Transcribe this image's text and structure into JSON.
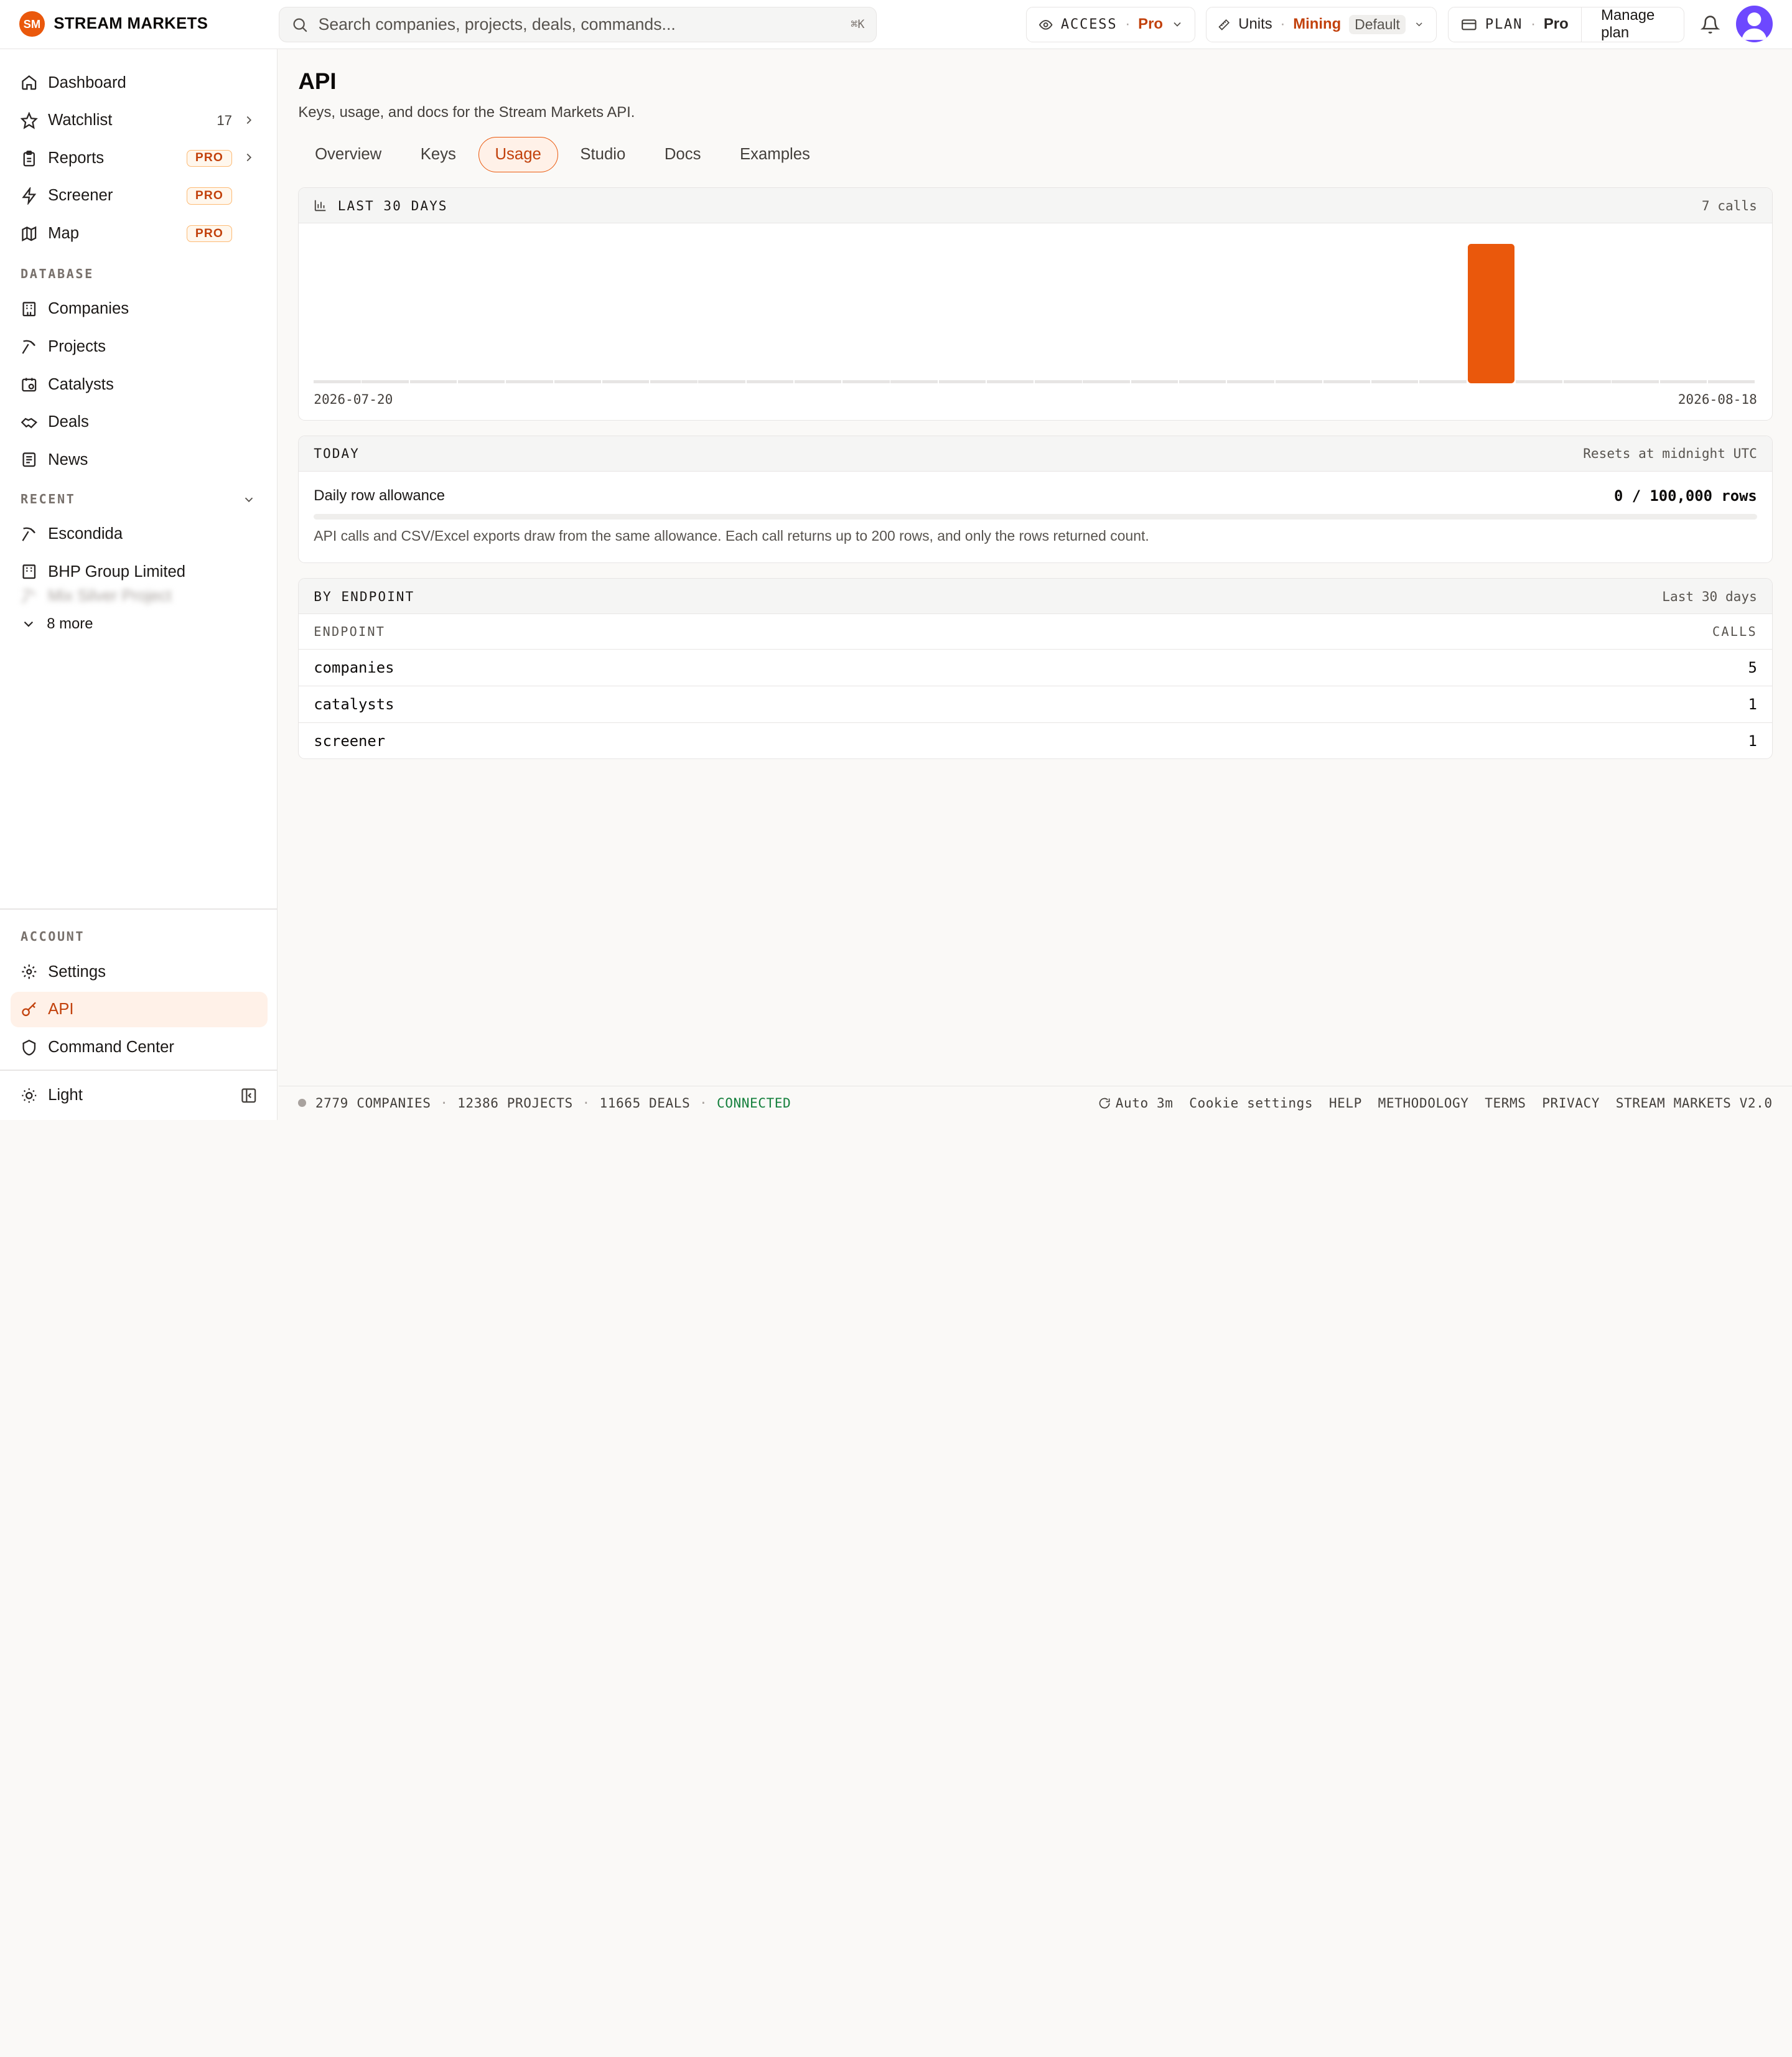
{
  "brand": {
    "logo_text": "SM",
    "name": "STREAM MARKETS"
  },
  "search": {
    "placeholder": "Search companies, projects, deals, commands...",
    "shortcut": "⌘K"
  },
  "access": {
    "label": "ACCESS",
    "value": "Pro"
  },
  "units": {
    "label": "Units",
    "value": "Mining",
    "chip": "Default"
  },
  "plan": {
    "label": "PLAN",
    "value": "Pro",
    "manage": "Manage plan"
  },
  "sidebar": {
    "main": [
      {
        "label": "Dashboard"
      },
      {
        "label": "Watchlist",
        "count": "17"
      },
      {
        "label": "Reports",
        "badge": "PRO"
      },
      {
        "label": "Screener",
        "badge": "PRO"
      },
      {
        "label": "Map",
        "badge": "PRO"
      }
    ],
    "database_label": "DATABASE",
    "database": [
      {
        "label": "Companies"
      },
      {
        "label": "Projects"
      },
      {
        "label": "Catalysts"
      },
      {
        "label": "Deals"
      },
      {
        "label": "News"
      }
    ],
    "recent_label": "RECENT",
    "recent": [
      {
        "label": "Escondida"
      },
      {
        "label": "BHP Group Limited"
      },
      {
        "label": "Mix Silver Project"
      }
    ],
    "more_label": "8 more",
    "account_label": "ACCOUNT",
    "account": [
      {
        "label": "Settings"
      },
      {
        "label": "API"
      },
      {
        "label": "Command Center"
      }
    ],
    "theme_label": "Light"
  },
  "page": {
    "title": "API",
    "subtitle": "Keys, usage, and docs for the Stream Markets API.",
    "tabs": [
      "Overview",
      "Keys",
      "Usage",
      "Studio",
      "Docs",
      "Examples"
    ]
  },
  "usage_chart": {
    "title": "LAST 30 DAYS",
    "meta": "7 calls"
  },
  "chart_data": {
    "type": "bar",
    "title": "LAST 30 DAYS",
    "x_start": "2026-07-20",
    "x_end": "2026-08-18",
    "values": [
      0,
      0,
      0,
      0,
      0,
      0,
      0,
      0,
      0,
      0,
      0,
      0,
      0,
      0,
      0,
      0,
      0,
      0,
      0,
      0,
      0,
      0,
      0,
      0,
      7,
      0,
      0,
      0,
      0,
      0
    ],
    "ylim": [
      0,
      7
    ],
    "color": "#ea580c"
  },
  "today": {
    "title": "TODAY",
    "meta": "Resets at midnight UTC",
    "allowance_label": "Daily row allowance",
    "allowance_value": "0 / 100,000 rows",
    "used_fraction": 0,
    "note": "API calls and CSV/Excel exports draw from the same allowance. Each call returns up to 200 rows, and only the rows returned count."
  },
  "by_endpoint": {
    "title": "BY ENDPOINT",
    "meta": "Last 30 days",
    "col_endpoint": "ENDPOINT",
    "col_calls": "CALLS",
    "rows": [
      {
        "endpoint": "companies",
        "calls": "5"
      },
      {
        "endpoint": "catalysts",
        "calls": "1"
      },
      {
        "endpoint": "screener",
        "calls": "1"
      }
    ]
  },
  "footer": {
    "companies": "2779 COMPANIES",
    "projects": "12386 PROJECTS",
    "deals": "11665 DEALS",
    "status": "CONNECTED",
    "auto": "Auto 3m",
    "links": [
      "Cookie settings",
      "HELP",
      "METHODOLOGY",
      "TERMS",
      "PRIVACY",
      "STREAM MARKETS V2.0"
    ]
  },
  "colors": {
    "accent": "#ea580c",
    "connected": "#15803d"
  }
}
